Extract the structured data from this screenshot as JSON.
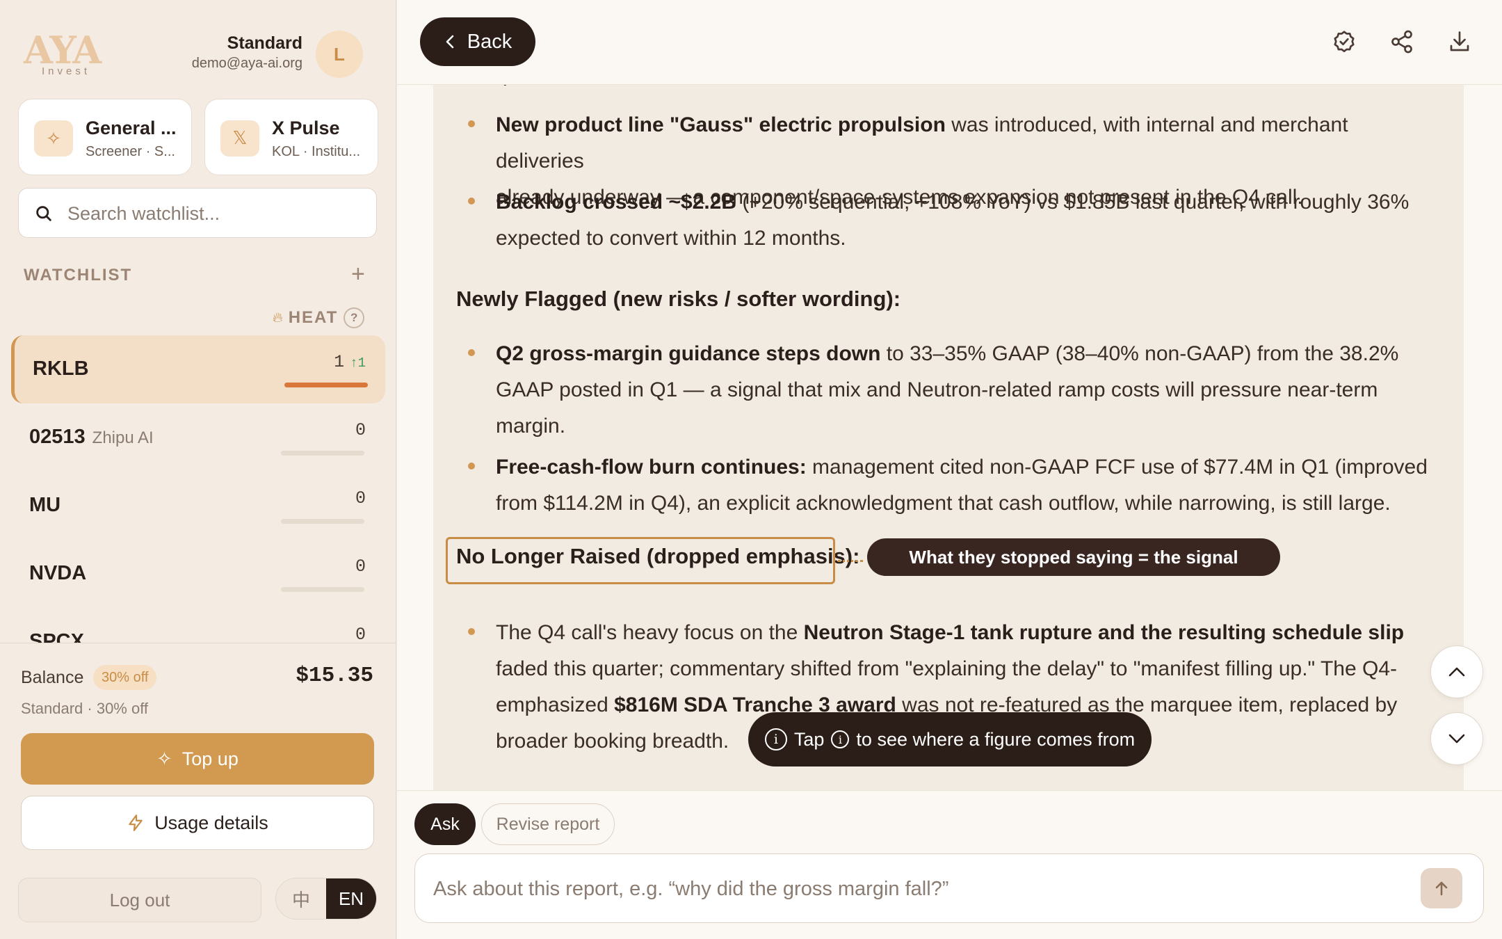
{
  "brand": {
    "logo_text": "AYA",
    "logo_sub": "Invest"
  },
  "account": {
    "plan": "Standard",
    "email": "demo@aya-ai.org",
    "avatar_initial": "L"
  },
  "feature_cards": [
    {
      "title": "General ...",
      "subtitle": "Screener · S...",
      "icon": "sparkle-icon"
    },
    {
      "title": "X Pulse",
      "subtitle": "KOL · Institu...",
      "icon": "x-logo-icon"
    }
  ],
  "search": {
    "placeholder": "Search watchlist..."
  },
  "watchlist": {
    "title": "WATCHLIST",
    "heat_label": "HEAT",
    "heat_help": "?",
    "items": [
      {
        "ticker": "RKLB",
        "name": "",
        "score": "1",
        "delta": "↑1",
        "heat_fraction": 1.0,
        "active": true
      },
      {
        "ticker": "02513",
        "name": "Zhipu AI",
        "score": "0",
        "delta": "",
        "heat_fraction": 0,
        "active": false
      },
      {
        "ticker": "MU",
        "name": "",
        "score": "0",
        "delta": "",
        "heat_fraction": 0,
        "active": false
      },
      {
        "ticker": "NVDA",
        "name": "",
        "score": "0",
        "delta": "",
        "heat_fraction": 0,
        "active": false
      },
      {
        "ticker": "SPCX",
        "name": "",
        "score": "0",
        "delta": "",
        "heat_fraction": 0,
        "active": false
      }
    ]
  },
  "balance": {
    "label": "Balance",
    "badge": "30% off",
    "amount": "$15.35",
    "subtitle": "Standard · 30% off",
    "topup_label": "Top up",
    "usage_label": "Usage details",
    "logout_label": "Log out"
  },
  "language": {
    "options": [
      "中",
      "EN"
    ],
    "selected": "EN"
  },
  "topbar": {
    "back_label": "Back"
  },
  "report": {
    "cut_top_text": "quarter.",
    "bullets_new": [
      {
        "bold": "New product line \"Gauss\" electric propulsion",
        "rest_line1": " was introduced, with internal and merchant deliveries",
        "line2": "already underway — a component/space-systems expansion not present in the Q4 call."
      },
      {
        "bold": "Backlog crossed ~$2.2B",
        "rest_line1": " (+20% sequential, +108% YoY) vs $1.85B last quarter, with roughly 36%",
        "line2": "expected to convert within 12 months."
      }
    ],
    "section_flagged": "Newly Flagged (new risks / softer wording):",
    "bullets_flagged": [
      {
        "bold": "Q2 gross-margin guidance steps down",
        "rest_line1": " to 33–35% GAAP (38–40% non-GAAP) from the 38.2%",
        "line2": "GAAP posted in Q1 — a signal that mix and Neutron-related ramp costs will pressure near-term",
        "line3": "margin."
      },
      {
        "bold": "Free-cash-flow burn continues:",
        "rest_line1": " management cited non-GAAP FCF use of $77.4M in Q1 (improved",
        "line2": "from $114.2M in Q4), an explicit acknowledgment that cash outflow, while narrowing, is still large."
      }
    ],
    "section_dropped": "No Longer Raised (dropped emphasis):",
    "signal_callout": "What they stopped saying = the signal",
    "bullet_dropped": {
      "pre": "The Q4 call's heavy focus on the ",
      "bold1": "Neutron Stage-1 tank rupture and the resulting schedule slip",
      "line2": "faded this quarter; commentary shifted from \"explaining the delay\" to \"manifest filling up.\" The Q4-",
      "line3_pre": "emphasized ",
      "bold2": "$816M SDA Tranche 3 award",
      "line3_post": " was not re-featured as the marquee item, replaced by",
      "line4": "broader booking breadth."
    }
  },
  "toast": {
    "pre": "Tap",
    "post": "to see where a figure comes from",
    "icon": "info-icon"
  },
  "ask": {
    "tabs": [
      "Ask",
      "Revise report"
    ],
    "selected_tab": "Ask",
    "placeholder": "Ask about this report, e.g. “why did the gross margin fall?”"
  },
  "colors": {
    "accent": "#d29753",
    "dark": "#2b1d17",
    "topup": "#d29a50",
    "heat_bar": "#d9773b",
    "positive": "#3c9a5f"
  }
}
